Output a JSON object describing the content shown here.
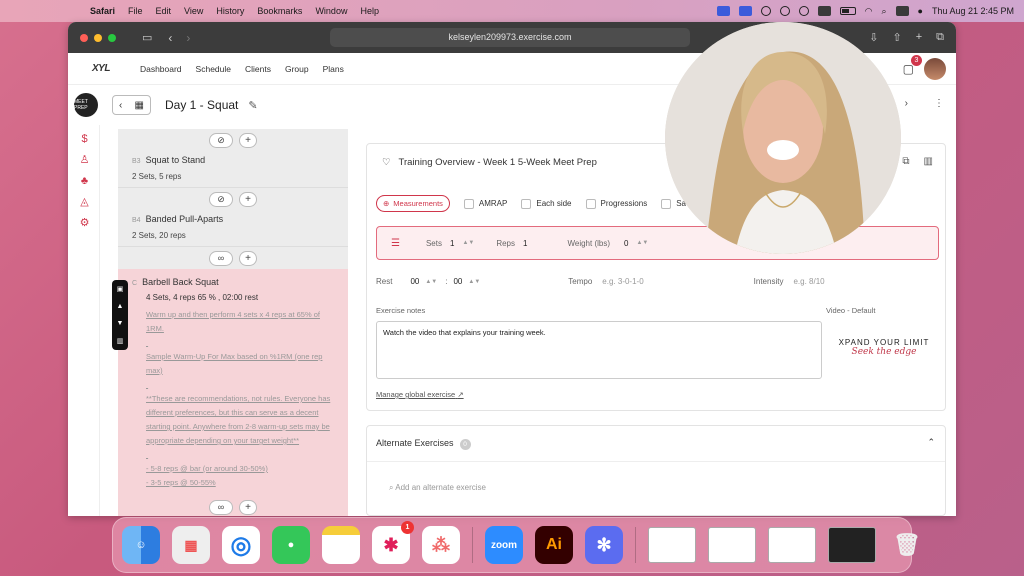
{
  "menubar": {
    "app": "Safari",
    "items": [
      "File",
      "Edit",
      "View",
      "History",
      "Bookmarks",
      "Window",
      "Help"
    ],
    "clock": "Thu Aug 21  2:45 PM"
  },
  "browser": {
    "url": "kelseylen209973.exercise.com"
  },
  "nav": {
    "logo": "XYL",
    "links": [
      "Dashboard",
      "Schedule",
      "Clients",
      "Group",
      "Plans"
    ],
    "notif_count": "3"
  },
  "header": {
    "day_title": "Day 1 - Squat",
    "avatar_text": "MEET PREP"
  },
  "exercises": [
    {
      "num": "B3",
      "name": "Squat to Stand",
      "sets": "2 Sets, 5 reps"
    },
    {
      "num": "B4",
      "name": "Banded Pull-Aparts",
      "sets": "2 Sets, 20 reps"
    }
  ],
  "selected": {
    "num": "C",
    "name": "Barbell Back Squat",
    "sets": "4 Sets, 4 reps 65 % , 02:00 rest",
    "desc": [
      "Warm up and then perform 4 sets x 4 reps at 65% of 1RM.",
      "",
      "Sample Warm-Up For Max based on %1RM (one rep max)",
      "",
      "**These are recommendations, not rules. Everyone has different preferences, but this can serve as a decent starting point. Anywhere from 2-8 warm-up sets may be appropriate depending on your target weight**",
      "",
      "- 5-8 reps @ bar (or around 30-50%)",
      "- 3-5 reps @ 50-55%"
    ]
  },
  "card": {
    "title": "Training Overview - Week 1 5-Week Meet Prep",
    "measurements": "Measurements",
    "amrap": "AMRAP",
    "each_side": "Each side",
    "progressions": "Progressions",
    "save": "Save",
    "sets_label": "Sets",
    "sets_val": "1",
    "reps_label": "Reps",
    "reps_val": "1",
    "weight_label": "Weight (lbs)",
    "weight_val": "0",
    "rest_label": "Rest",
    "rest_min": "00",
    "rest_sep": ":",
    "rest_sec": "00",
    "tempo_label": "Tempo",
    "tempo_ph": "e.g. 3-0-1-0",
    "intensity_label": "Intensity",
    "intensity_ph": "e.g. 8/10",
    "notes_label": "Exercise notes",
    "notes": "Watch the video that explains your training week.",
    "video_label": "Video - Default",
    "brand_a": "XPAND YOUR LIMIT",
    "brand_b": "Seek the edge",
    "manage": "Manage global exercise"
  },
  "alternates": {
    "title": "Alternate Exercises",
    "count": "0",
    "search_ph": "Add an alternate exercise"
  },
  "dock": {
    "zoom": "zoom",
    "ai": "Ai",
    "slack_badge": "1"
  }
}
